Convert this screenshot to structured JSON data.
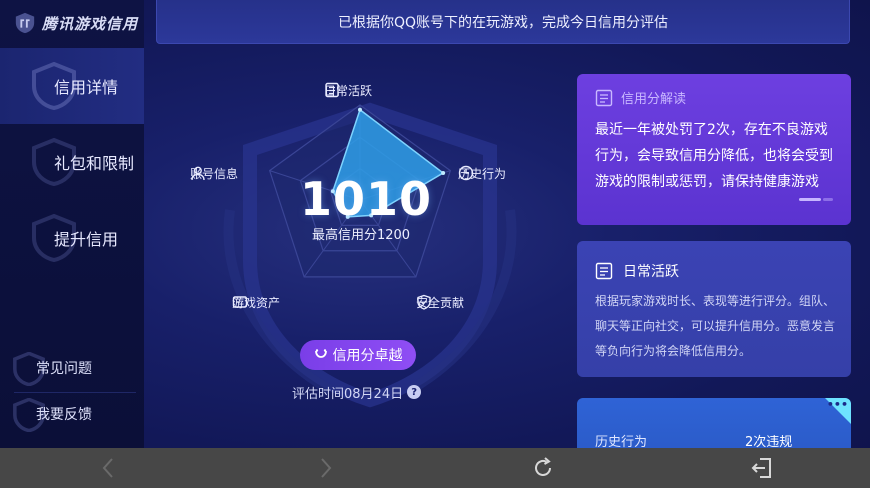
{
  "app": {
    "brand": "腾讯游戏信用"
  },
  "banner": {
    "text": "已根据你QQ账号下的在玩游戏，完成今日信用分评估"
  },
  "sidebar": {
    "items": [
      {
        "label": "信用详情",
        "active": true
      },
      {
        "label": "礼包和限制",
        "active": false
      },
      {
        "label": "提升信用",
        "active": false
      }
    ],
    "bottom": [
      {
        "label": "常见问题"
      },
      {
        "label": "我要反馈"
      }
    ]
  },
  "radar": {
    "score": "1010",
    "max_label": "最高信用分1200",
    "axes": [
      {
        "label": "日常活跃",
        "icon": "document-icon",
        "value": 0.95
      },
      {
        "label": "历史行为",
        "icon": "clock-icon",
        "value": 0.92
      },
      {
        "label": "安全贡献",
        "icon": "shield-icon",
        "value": 0.2
      },
      {
        "label": "游戏资产",
        "icon": "wallet-icon",
        "value": 0.22
      },
      {
        "label": "账号信息",
        "icon": "user-icon",
        "value": 0.3
      }
    ],
    "fill_color": "#2f9fe8",
    "stroke_color": "#7fd4ff"
  },
  "level": {
    "label": "信用分卓越",
    "icon": "smile-icon"
  },
  "eval": {
    "text": "评估时间08月24日"
  },
  "cards": {
    "interpret": {
      "title": "信用分解读",
      "body": "最近一年被处罚了2次，存在不良游戏行为，会导致信用分降低，也将会受到游戏的限制或惩罚，请保持健康游戏"
    },
    "daily": {
      "title": "日常活跃",
      "body": "根据玩家游戏时长、表现等进行评分。组队、聊天等正向社交，可以提升信用分。恶意发言等负向行为将会降低信用分。"
    },
    "history": {
      "label": "历史行为",
      "value": "2次违规",
      "more": "•••"
    }
  },
  "colors": {
    "accent_purple": "#7a3ee8",
    "card_interpret": "#6d3fe0",
    "card_daily": "#3b43b4",
    "card_history": "#2f63d6",
    "background": "#18206a"
  }
}
